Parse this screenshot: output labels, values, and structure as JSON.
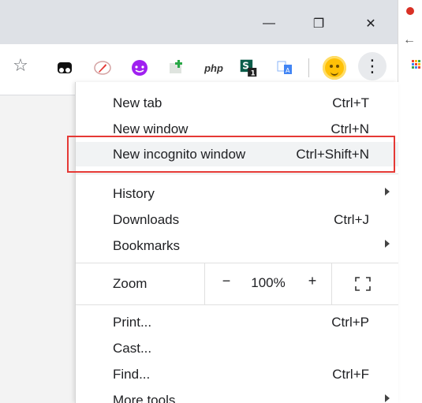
{
  "window": {
    "minimize_label": "—",
    "restore_label": "❐",
    "close_label": "✕"
  },
  "toolbar": {
    "bookmark_icon": "star-icon",
    "php_label": "php",
    "menu_icon": "kebab-menu-icon"
  },
  "menu": {
    "items": [
      {
        "label": "New tab",
        "shortcut": "Ctrl+T"
      },
      {
        "label": "New window",
        "shortcut": "Ctrl+N"
      },
      {
        "label": "New incognito window",
        "shortcut": "Ctrl+Shift+N"
      },
      {
        "label": "History",
        "shortcut": ""
      },
      {
        "label": "Downloads",
        "shortcut": "Ctrl+J"
      },
      {
        "label": "Bookmarks",
        "shortcut": ""
      },
      {
        "label": "Print...",
        "shortcut": "Ctrl+P"
      },
      {
        "label": "Cast...",
        "shortcut": ""
      },
      {
        "label": "Find...",
        "shortcut": "Ctrl+F"
      },
      {
        "label": "More tools",
        "shortcut": ""
      }
    ],
    "zoom": {
      "label": "Zoom",
      "minus": "−",
      "value": "100%",
      "plus": "+"
    }
  },
  "colors": {
    "highlight_border": "#e53935",
    "selected_background": "#f1f3f4",
    "titlebar": "#dee1e6"
  }
}
